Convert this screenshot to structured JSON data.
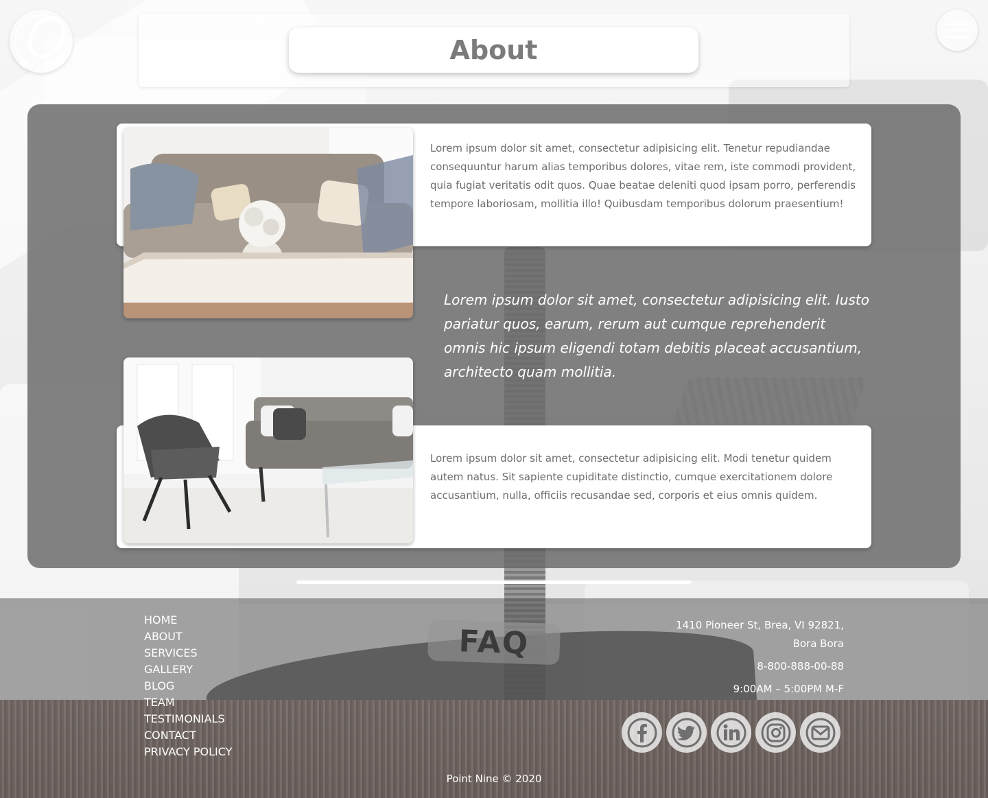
{
  "header": {
    "title": "About",
    "logo_icon": "point-nine-logo",
    "menu_icon": "hamburger-menu-icon"
  },
  "about": {
    "card1_text": "Lorem ipsum dolor sit amet, consectetur adipisicing elit. Tenetur repudiandae consequuntur harum alias temporibus dolores, vitae rem, iste commodi provident, quia fugiat veritatis odit quos. Quae beatae deleniti quod ipsam porro, perferendis tempore laboriosam, mollitia illo! Quibusdam temporibus dolorum praesentium!",
    "quote": "Lorem ipsum dolor sit amet, consectetur adipisicing elit. Iusto pariatur quos, earum, rerum aut cumque reprehenderit omnis hic ipsum eligendi totam debitis placeat accusantium, architecto quam mollitia.",
    "card2_text": "Lorem ipsum dolor sit amet, consectetur adipisicing elit. Modi tenetur quidem autem natus. Sit sapiente cupiditate distinctio, cumque exercitationem dolore accusantium, nulla, officiis recusandae sed, corporis et eius omnis quidem."
  },
  "footer": {
    "nav": [
      "HOME",
      "ABOUT",
      "SERVICES",
      "GALLERY",
      "BLOG",
      "TEAM",
      "TESTIMONIALS",
      "CONTACT",
      "PRIVACY POLICY"
    ],
    "faq_label": "FAQ",
    "address_line1": "1410 Pioneer St, Brea, VI 92821,",
    "address_line2": "Bora Bora",
    "phone": "8-800-888-00-88",
    "hours": "9:00AM – 5:00PM M-F",
    "social": [
      "facebook-icon",
      "twitter-icon",
      "linkedin-icon",
      "instagram-icon",
      "email-icon"
    ],
    "copyright": "Point Nine © 2020"
  },
  "colors": {
    "panel": "#6c6c6c",
    "title_text": "#7b7b7b",
    "body_text": "#6d6d6d",
    "white": "#ffffff"
  }
}
